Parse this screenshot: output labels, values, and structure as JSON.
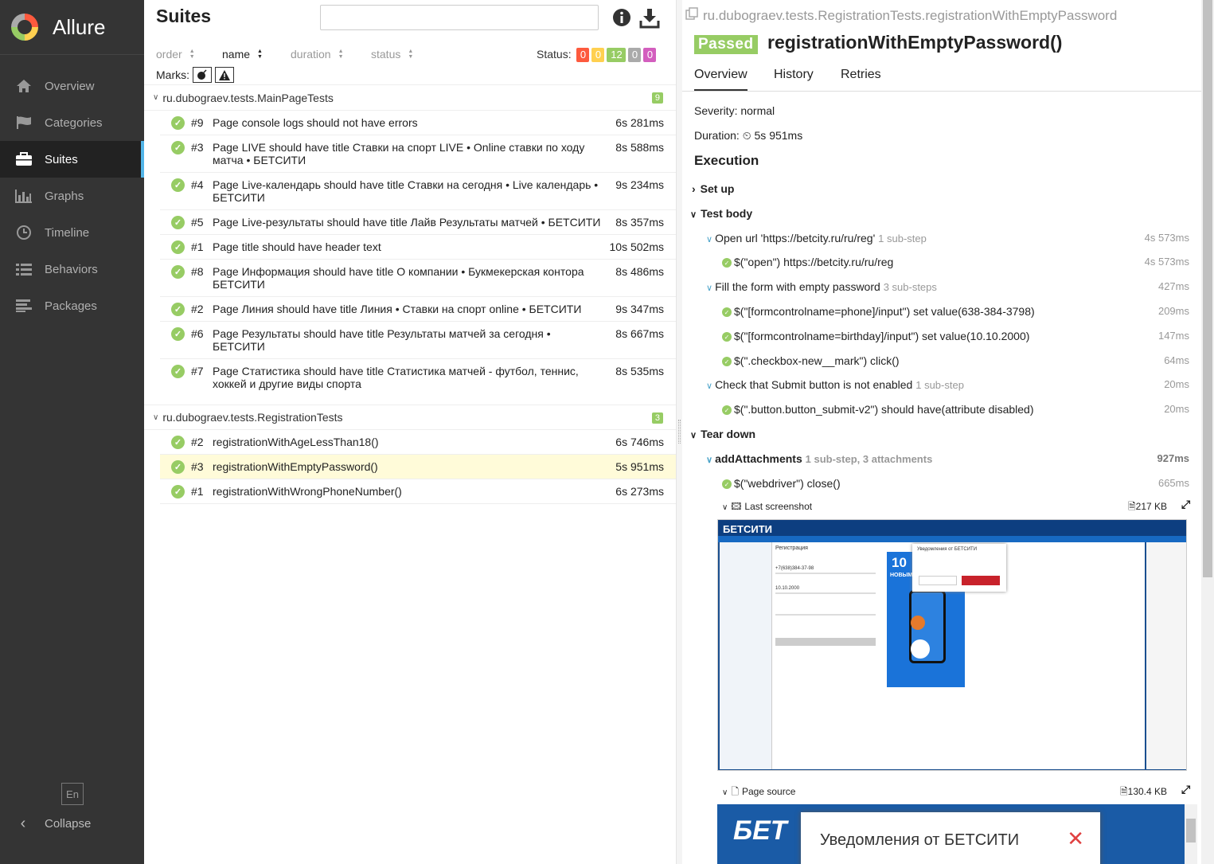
{
  "sidebar": {
    "brand": "Allure",
    "items": [
      {
        "label": "Overview",
        "icon": "home-icon"
      },
      {
        "label": "Categories",
        "icon": "flag-icon"
      },
      {
        "label": "Suites",
        "icon": "briefcase-icon",
        "active": true
      },
      {
        "label": "Graphs",
        "icon": "bar-chart-icon"
      },
      {
        "label": "Timeline",
        "icon": "clock-icon"
      },
      {
        "label": "Behaviors",
        "icon": "list-icon"
      },
      {
        "label": "Packages",
        "icon": "align-left-icon"
      }
    ],
    "lang": "En",
    "collapse": "Collapse"
  },
  "suites": {
    "title": "Suites",
    "search_value": "",
    "sort": {
      "order": "order",
      "name": "name",
      "duration": "duration",
      "status": "status"
    },
    "status_label": "Status:",
    "status_counts": {
      "failed": "0",
      "broken": "0",
      "passed": "12",
      "skipped": "0",
      "unknown": "0"
    },
    "marks_label": "Marks:",
    "groups": [
      {
        "name": "ru.dubograev.tests.MainPageTests",
        "count": "9",
        "rows": [
          {
            "num": "#9",
            "name": "Page console logs should not have errors",
            "dur": "6s 281ms"
          },
          {
            "num": "#3",
            "name": "Page LIVE should have title Ставки на спорт LIVE • Online ставки по ходу матча • БЕТСИТИ",
            "dur": "8s 588ms"
          },
          {
            "num": "#4",
            "name": "Page Live-календарь should have title Ставки на сегодня • Live календарь • БЕТСИТИ",
            "dur": "9s 234ms"
          },
          {
            "num": "#5",
            "name": "Page Live-результаты should have title Лайв Результаты матчей • БЕТСИТИ",
            "dur": "8s 357ms"
          },
          {
            "num": "#1",
            "name": "Page title should have header text",
            "dur": "10s 502ms"
          },
          {
            "num": "#8",
            "name": "Page Информация should have title О компании • Букмекерская контора БЕТСИТИ",
            "dur": "8s 486ms"
          },
          {
            "num": "#2",
            "name": "Page Линия should have title Линия • Ставки на спорт online • БЕТСИТИ",
            "dur": "9s 347ms"
          },
          {
            "num": "#6",
            "name": "Page Результаты should have title Результаты матчей за сегодня • БЕТСИТИ",
            "dur": "8s 667ms"
          },
          {
            "num": "#7",
            "name": "Page Статистика should have title Статистика матчей - футбол, теннис, хоккей и другие виды спорта",
            "dur": "8s 535ms"
          }
        ]
      },
      {
        "name": "ru.dubograev.tests.RegistrationTests",
        "count": "3",
        "rows": [
          {
            "num": "#2",
            "name": "registrationWithAgeLessThan18()",
            "dur": "6s 746ms"
          },
          {
            "num": "#3",
            "name": "registrationWithEmptyPassword()",
            "dur": "5s 951ms",
            "selected": true
          },
          {
            "num": "#1",
            "name": "registrationWithWrongPhoneNumber()",
            "dur": "6s 273ms"
          }
        ]
      }
    ]
  },
  "detail": {
    "crumb": "ru.dubograev.tests.RegistrationTests.registrationWithEmptyPassword",
    "status": "Passed",
    "title": "registrationWithEmptyPassword()",
    "tabs": [
      "Overview",
      "History",
      "Retries"
    ],
    "severity": "Severity: normal",
    "duration_label": "Duration:",
    "duration": "5s 951ms",
    "execution": "Execution",
    "setup": "Set up",
    "body": "Test body",
    "teardown": "Tear down",
    "steps": [
      {
        "text": "Open url 'https://betcity.ru/ru/reg'",
        "sub": "1 sub-step",
        "time": "4s 573ms"
      },
      {
        "text": "$(\"open\") https://betcity.ru/ru/reg",
        "time": "4s 573ms"
      },
      {
        "text": "Fill the form with empty password",
        "sub": "3 sub-steps",
        "time": "427ms"
      },
      {
        "text": "$(\"[formcontrolname=phone]/input\") set value(638-384-3798)",
        "time": "209ms"
      },
      {
        "text": "$(\"[formcontrolname=birthday]/input\") set value(10.10.2000)",
        "time": "147ms"
      },
      {
        "text": "$(\".checkbox-new__mark\") click()",
        "time": "64ms"
      },
      {
        "text": "Check that Submit button is not enabled",
        "sub": "1 sub-step",
        "time": "20ms"
      },
      {
        "text": "$(\".button.button_submit-v2\") should have(attribute disabled)",
        "time": "20ms"
      },
      {
        "text": "addAttachments",
        "sub": "1 sub-step, 3 attachments",
        "time": "927ms"
      },
      {
        "text": "$(\"webdriver\") close()",
        "time": "665ms"
      }
    ],
    "attachments": [
      {
        "name": "Last screenshot",
        "size": "217 KB"
      },
      {
        "name": "Page source",
        "size": "130.4 KB"
      }
    ],
    "screenshot": {
      "brand": "БЕТСИТИ",
      "promo": "10",
      "promo_text": "НОВЫМ ИГРОКАМ",
      "dialog": "Уведомления от БЕТСИТИ",
      "reg": "Регистрация",
      "phone": "+7(638)384-37-98",
      "bday": "10.10.2000"
    },
    "source": {
      "brand": "БЕТ",
      "dialog": "Уведомления от БЕТСИТИ"
    }
  }
}
